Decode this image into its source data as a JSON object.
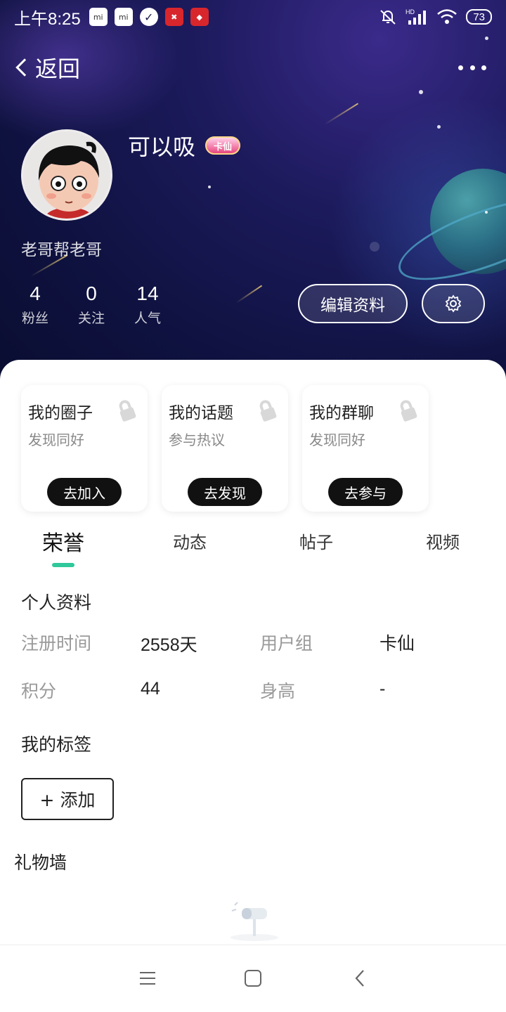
{
  "status_bar": {
    "time": "上午8:25",
    "battery": "73",
    "icons": [
      "mi-icon",
      "mi-icon",
      "check-circle-icon",
      "app-badge-icon",
      "app-badge-icon",
      "mute-icon",
      "hd-signal-icon",
      "wifi-icon",
      "battery-icon"
    ]
  },
  "header": {
    "back_label": "返回",
    "more_icon": "more-dots-icon"
  },
  "profile": {
    "username": "可以吸",
    "badge": "卡仙",
    "signature": "老哥帮老哥",
    "stats": [
      {
        "value": "4",
        "label": "粉丝"
      },
      {
        "value": "0",
        "label": "关注"
      },
      {
        "value": "14",
        "label": "人气"
      }
    ],
    "edit_label": "编辑资料",
    "settings_icon": "gear-icon"
  },
  "cards": [
    {
      "title": "我的圈子",
      "subtitle": "发现同好",
      "button": "去加入"
    },
    {
      "title": "我的话题",
      "subtitle": "参与热议",
      "button": "去发现"
    },
    {
      "title": "我的群聊",
      "subtitle": "发现同好",
      "button": "去参与"
    }
  ],
  "tabs": [
    "荣誉",
    "动态",
    "帖子",
    "视频"
  ],
  "active_tab": "荣誉",
  "personal_info": {
    "title": "个人资料",
    "rows": [
      {
        "label1": "注册时间",
        "value1": "2558天",
        "label2": "用户组",
        "value2": "卡仙"
      },
      {
        "label1": "积分",
        "value1": "44",
        "label2": "身高",
        "value2": "-"
      }
    ]
  },
  "tags": {
    "title": "我的标签",
    "add_label": "+ 添加"
  },
  "gift_wall": {
    "title": "礼物墙"
  },
  "nav": [
    "menu-icon",
    "home-square-icon",
    "back-chevron-icon"
  ],
  "colors": {
    "accent": "#2fc89a",
    "hero_bg": "#0f1240",
    "button_dark": "#111111"
  }
}
